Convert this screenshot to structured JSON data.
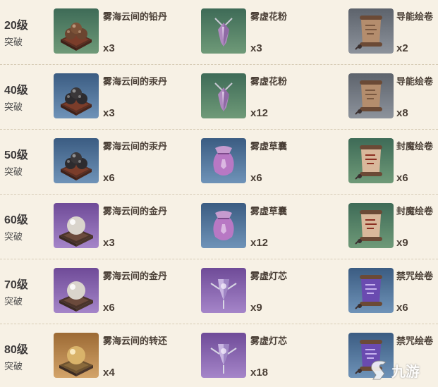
{
  "rows": [
    {
      "level": "20级",
      "ascend": "突破",
      "items": [
        {
          "name": "雾海云间的铅丹",
          "count": "x3",
          "icon": "lead-pill-icon",
          "bg": "green"
        },
        {
          "name": "雾虚花粉",
          "count": "x3",
          "icon": "mist-pollen-icon",
          "bg": "green"
        },
        {
          "name": "导能绘卷",
          "count": "x2",
          "icon": "guide-scroll-icon",
          "bg": "gray"
        }
      ]
    },
    {
      "level": "40级",
      "ascend": "突破",
      "items": [
        {
          "name": "雾海云间的汞丹",
          "count": "x3",
          "icon": "mercury-pill-icon",
          "bg": "blue"
        },
        {
          "name": "雾虚花粉",
          "count": "x12",
          "icon": "mist-pollen-icon",
          "bg": "green"
        },
        {
          "name": "导能绘卷",
          "count": "x8",
          "icon": "guide-scroll-icon",
          "bg": "gray"
        }
      ]
    },
    {
      "level": "50级",
      "ascend": "突破",
      "items": [
        {
          "name": "雾海云间的汞丹",
          "count": "x6",
          "icon": "mercury-pill-icon",
          "bg": "blue"
        },
        {
          "name": "雾虚草囊",
          "count": "x6",
          "icon": "mist-pouch-icon",
          "bg": "blue"
        },
        {
          "name": "封魔绘卷",
          "count": "x6",
          "icon": "sealing-scroll-icon",
          "bg": "green"
        }
      ]
    },
    {
      "level": "60级",
      "ascend": "突破",
      "items": [
        {
          "name": "雾海云间的金丹",
          "count": "x3",
          "icon": "gold-pill-icon",
          "bg": "purple"
        },
        {
          "name": "雾虚草囊",
          "count": "x12",
          "icon": "mist-pouch-icon",
          "bg": "blue"
        },
        {
          "name": "封魔绘卷",
          "count": "x9",
          "icon": "sealing-scroll-icon",
          "bg": "green"
        }
      ]
    },
    {
      "level": "70级",
      "ascend": "突破",
      "items": [
        {
          "name": "雾海云间的金丹",
          "count": "x6",
          "icon": "gold-pill-icon",
          "bg": "purple"
        },
        {
          "name": "雾虚灯芯",
          "count": "x9",
          "icon": "mist-wick-icon",
          "bg": "purple"
        },
        {
          "name": "禁咒绘卷",
          "count": "x6",
          "icon": "forbidden-scroll-icon",
          "bg": "blue"
        }
      ]
    },
    {
      "level": "80级",
      "ascend": "突破",
      "items": [
        {
          "name": "雾海云间的转还",
          "count": "x4",
          "icon": "returning-pill-icon",
          "bg": "gold"
        },
        {
          "name": "雾虚灯芯",
          "count": "x18",
          "icon": "mist-wick-icon",
          "bg": "purple"
        },
        {
          "name": "禁咒绘卷",
          "count": "",
          "icon": "forbidden-scroll-icon",
          "bg": "blue"
        }
      ]
    }
  ],
  "watermark": {
    "text": "九游",
    "icon": "jiuyou-logo-icon"
  },
  "colors": {
    "page_bg": "#f7f1e5",
    "rarity_green": "#4f7a66",
    "rarity_blue": "#4f6f93",
    "rarity_purple": "#8a64b0",
    "rarity_gold": "#b98546",
    "rarity_gray": "#6f757f"
  }
}
